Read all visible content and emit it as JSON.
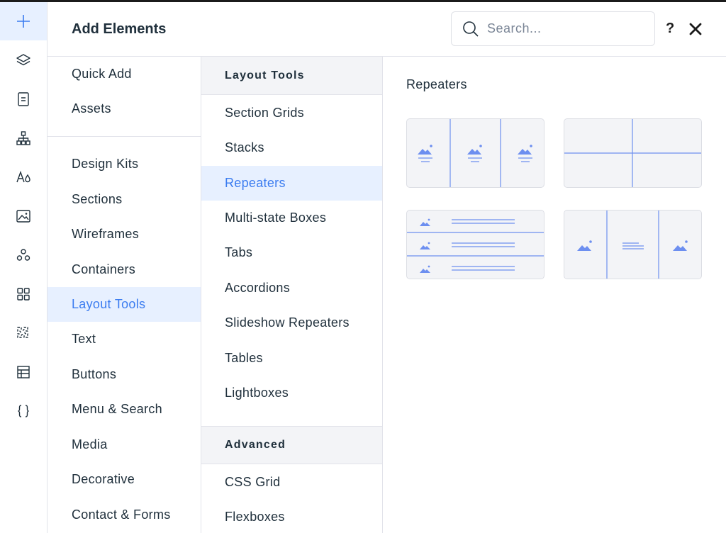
{
  "panel": {
    "title": "Add Elements",
    "search_placeholder": "Search...",
    "help_label": "?"
  },
  "rail": [
    {
      "icon": "plus-icon",
      "active": true
    },
    {
      "icon": "layers-icon"
    },
    {
      "icon": "page-icon"
    },
    {
      "icon": "sitemap-icon"
    },
    {
      "icon": "theme-icon"
    },
    {
      "icon": "media-icon"
    },
    {
      "icon": "apps-icon"
    },
    {
      "icon": "grid-icon"
    },
    {
      "icon": "puzzle-icon"
    },
    {
      "icon": "table-icon"
    },
    {
      "icon": "code-braces-icon"
    }
  ],
  "categories": {
    "group1": [
      "Quick Add",
      "Assets"
    ],
    "group2": [
      "Design Kits",
      "Sections",
      "Wireframes",
      "Containers",
      "Layout Tools",
      "Text",
      "Buttons",
      "Menu & Search",
      "Media",
      "Decorative",
      "Contact & Forms"
    ],
    "active": "Layout Tools"
  },
  "subcategories": {
    "layout_heading": "Layout Tools",
    "layout_items": [
      "Section Grids",
      "Stacks",
      "Repeaters",
      "Multi-state Boxes",
      "Tabs",
      "Accordions",
      "Slideshow Repeaters",
      "Tables",
      "Lightboxes"
    ],
    "advanced_heading": "Advanced",
    "advanced_items": [
      "CSS Grid",
      "Flexboxes"
    ],
    "active": "Repeaters"
  },
  "content": {
    "title": "Repeaters",
    "accent_color": "#6d8ff0",
    "cards": [
      "repeater-three-columns",
      "repeater-grid-2x2",
      "repeater-list-rows",
      "repeater-three-columns-text"
    ]
  }
}
